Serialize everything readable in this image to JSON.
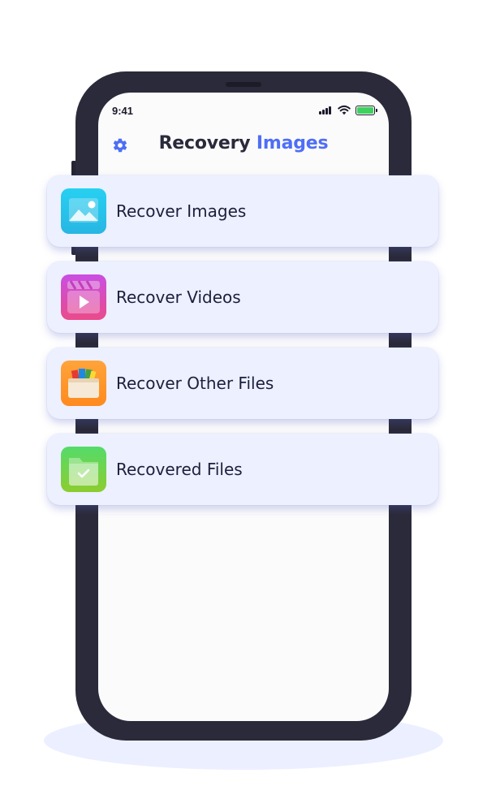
{
  "status_bar": {
    "time": "9:41"
  },
  "header": {
    "title_part1": "Recovery",
    "title_part2": "Images",
    "settings_icon": "gear-icon"
  },
  "menu": [
    {
      "label": "Recover Images",
      "icon": "image-icon"
    },
    {
      "label": "Recover Videos",
      "icon": "video-clapper-icon"
    },
    {
      "label": "Recover Other Files",
      "icon": "file-box-icon"
    },
    {
      "label": "Recovered Files",
      "icon": "folder-check-icon"
    }
  ],
  "colors": {
    "accent": "#4f6ef7",
    "title": "#2a2a3c",
    "card_bg": "#ecf0ff"
  }
}
